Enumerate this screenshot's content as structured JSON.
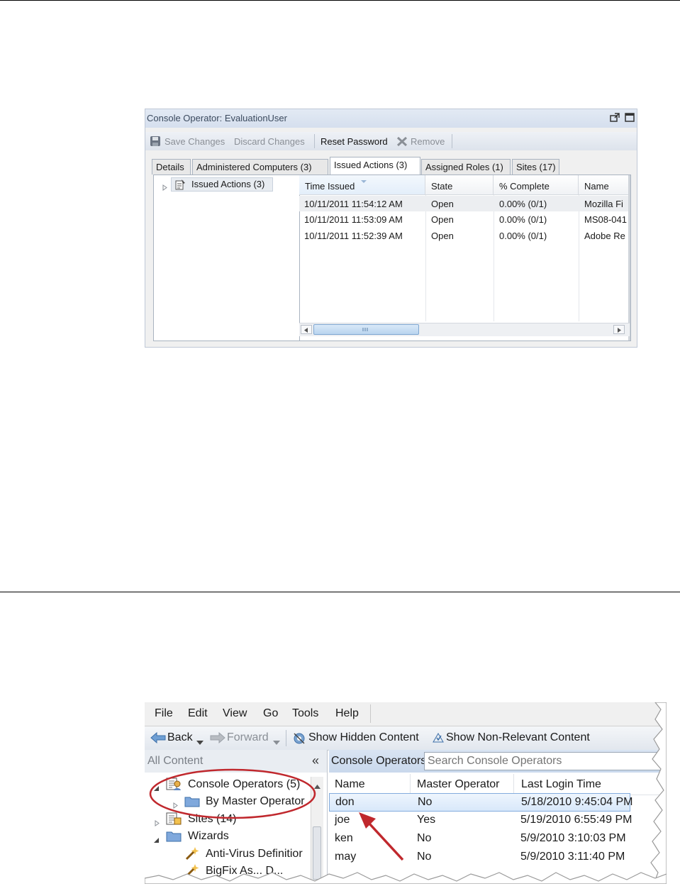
{
  "screenshot1": {
    "window_title": "Console Operator: EvaluationUser",
    "toolbar": {
      "save_changes": "Save Changes",
      "discard_changes": "Discard Changes",
      "reset_password": "Reset Password",
      "remove": "Remove"
    },
    "tabs": [
      {
        "label": "Details"
      },
      {
        "label": "Administered Computers (3)"
      },
      {
        "label": "Issued Actions (3)"
      },
      {
        "label": "Assigned Roles (1)"
      },
      {
        "label": "Sites (17)"
      }
    ],
    "active_tab": "Issued Actions (3)",
    "tree_item": "Issued Actions (3)",
    "columns": [
      "Time Issued",
      "State",
      "% Complete",
      "Name"
    ],
    "rows": [
      {
        "time": "10/11/2011 11:54:12 AM",
        "state": "Open",
        "complete": "0.00% (0/1)",
        "name": "Mozilla Fi"
      },
      {
        "time": "10/11/2011 11:53:09 AM",
        "state": "Open",
        "complete": "0.00% (0/1)",
        "name": "MS08-041"
      },
      {
        "time": "10/11/2011 11:52:39 AM",
        "state": "Open",
        "complete": "0.00% (0/1)",
        "name": "Adobe Re"
      }
    ]
  },
  "screenshot2": {
    "menu": [
      "File",
      "Edit",
      "View",
      "Go",
      "Tools",
      "Help"
    ],
    "toolbar": {
      "back": "Back",
      "forward": "Forward",
      "show_hidden": "Show Hidden Content",
      "show_nonrelevant": "Show Non-Relevant Content"
    },
    "left_pane_title": "All Content",
    "collapse_glyph": "«",
    "tree": {
      "console_operators": "Console Operators (5)",
      "by_master_operator": "By Master Operator",
      "sites": "Sites (14)",
      "wizards": "Wizards",
      "antivirus": "Anti-Virus Definitior",
      "bigfix": "BigFix As... D..."
    },
    "right_pane_title": "Console Operators",
    "search_placeholder": "Search Console Operators",
    "columns": [
      "Name",
      "Master Operator",
      "Last Login Time"
    ],
    "rows": [
      {
        "name": "don",
        "master": "No",
        "login": "5/18/2010 9:45:04 PM"
      },
      {
        "name": "joe",
        "master": "Yes",
        "login": "5/19/2010 6:55:49 PM"
      },
      {
        "name": "ken",
        "master": "No",
        "login": "5/9/2010 3:10:03 PM"
      },
      {
        "name": "may",
        "master": "No",
        "login": "5/9/2010 3:11:40 PM"
      }
    ],
    "annotation_color": "#c0282d"
  }
}
